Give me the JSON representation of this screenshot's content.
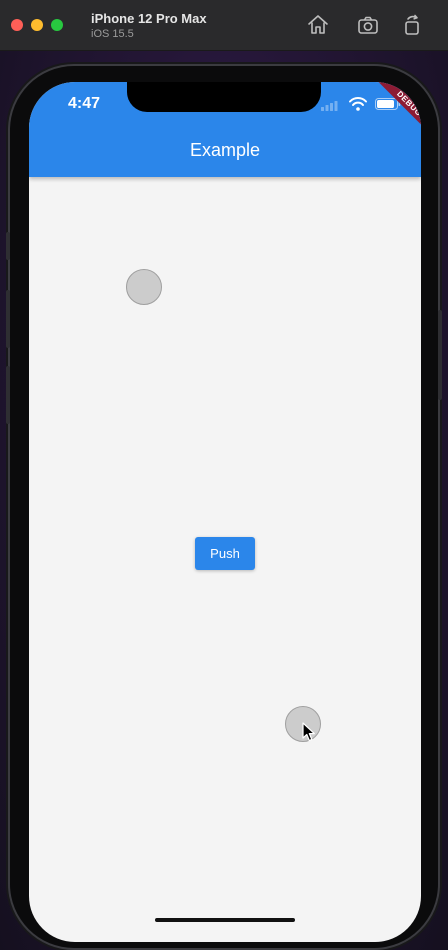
{
  "window": {
    "device_name": "iPhone 12 Pro Max",
    "os_version": "iOS 15.5",
    "toolbar_icons": [
      "home-icon",
      "screenshot-icon",
      "rotate-icon"
    ]
  },
  "status_bar": {
    "time": "4:47",
    "icons": [
      "signal-icon",
      "wifi-icon",
      "battery-icon"
    ]
  },
  "app": {
    "title": "Example",
    "debug_banner": "DEBUG",
    "push_button_label": "Push",
    "accent_color": "#2b86ea"
  }
}
